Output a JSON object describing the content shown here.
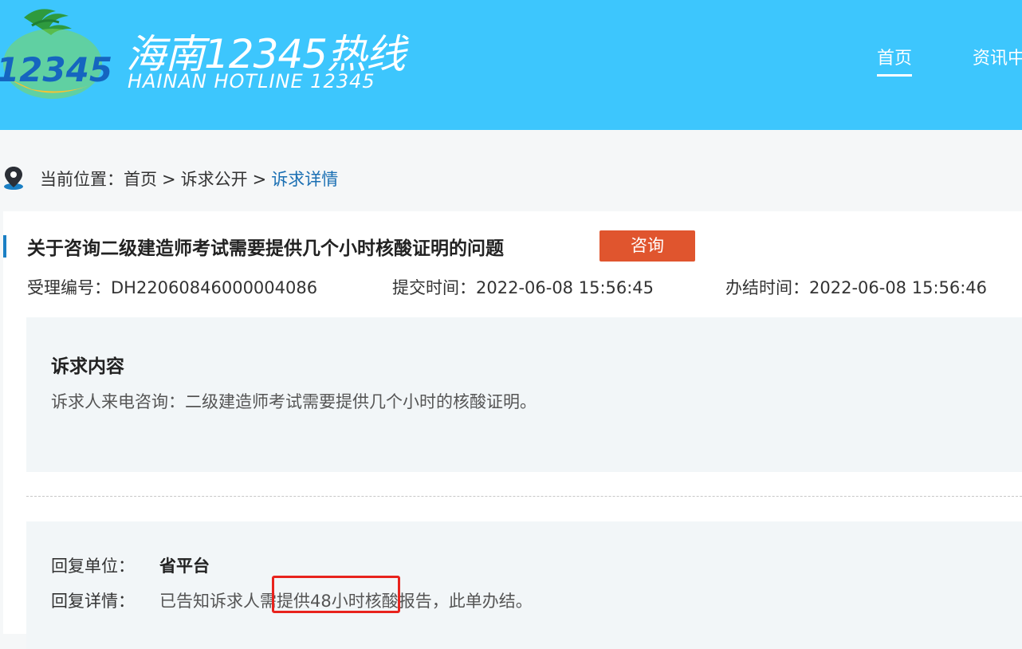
{
  "header": {
    "brand_cn": "海南12345热线",
    "brand_en": "HAINAN HOTLINE 12345",
    "logo_text": "12345",
    "nav": [
      {
        "label": "首页",
        "active": true
      },
      {
        "label": "资讯中"
      }
    ]
  },
  "breadcrumb": {
    "prefix": "当前位置：",
    "items": [
      "首页",
      "诉求公开"
    ],
    "separator": ">",
    "current": "诉求详情"
  },
  "detail": {
    "title": "关于咨询二级建造师考试需要提供几个小时核酸证明的问题",
    "tag": "咨询",
    "id_label": "受理编号：",
    "id_value": "DH22060846000004086",
    "submit_label": "提交时间：",
    "submit_value": "2022-06-08 15:56:45",
    "done_label": "办结时间：",
    "done_value": "2022-06-08 15:56:46"
  },
  "content": {
    "title": "诉求内容",
    "text": "诉求人来电咨询：二级建造师考试需要提供几个小时的核酸证明。"
  },
  "reply": {
    "unit_label": "回复单位：",
    "unit_value": "省平台",
    "detail_label": "回复详情：",
    "detail_value": "已告知诉求人需提供48小时核酸报告，此单办结。"
  },
  "colors": {
    "header_bg": "#3dc6fd",
    "tag_bg": "#e0552e",
    "link": "#1a6fb3",
    "highlight": "#e8231d"
  }
}
